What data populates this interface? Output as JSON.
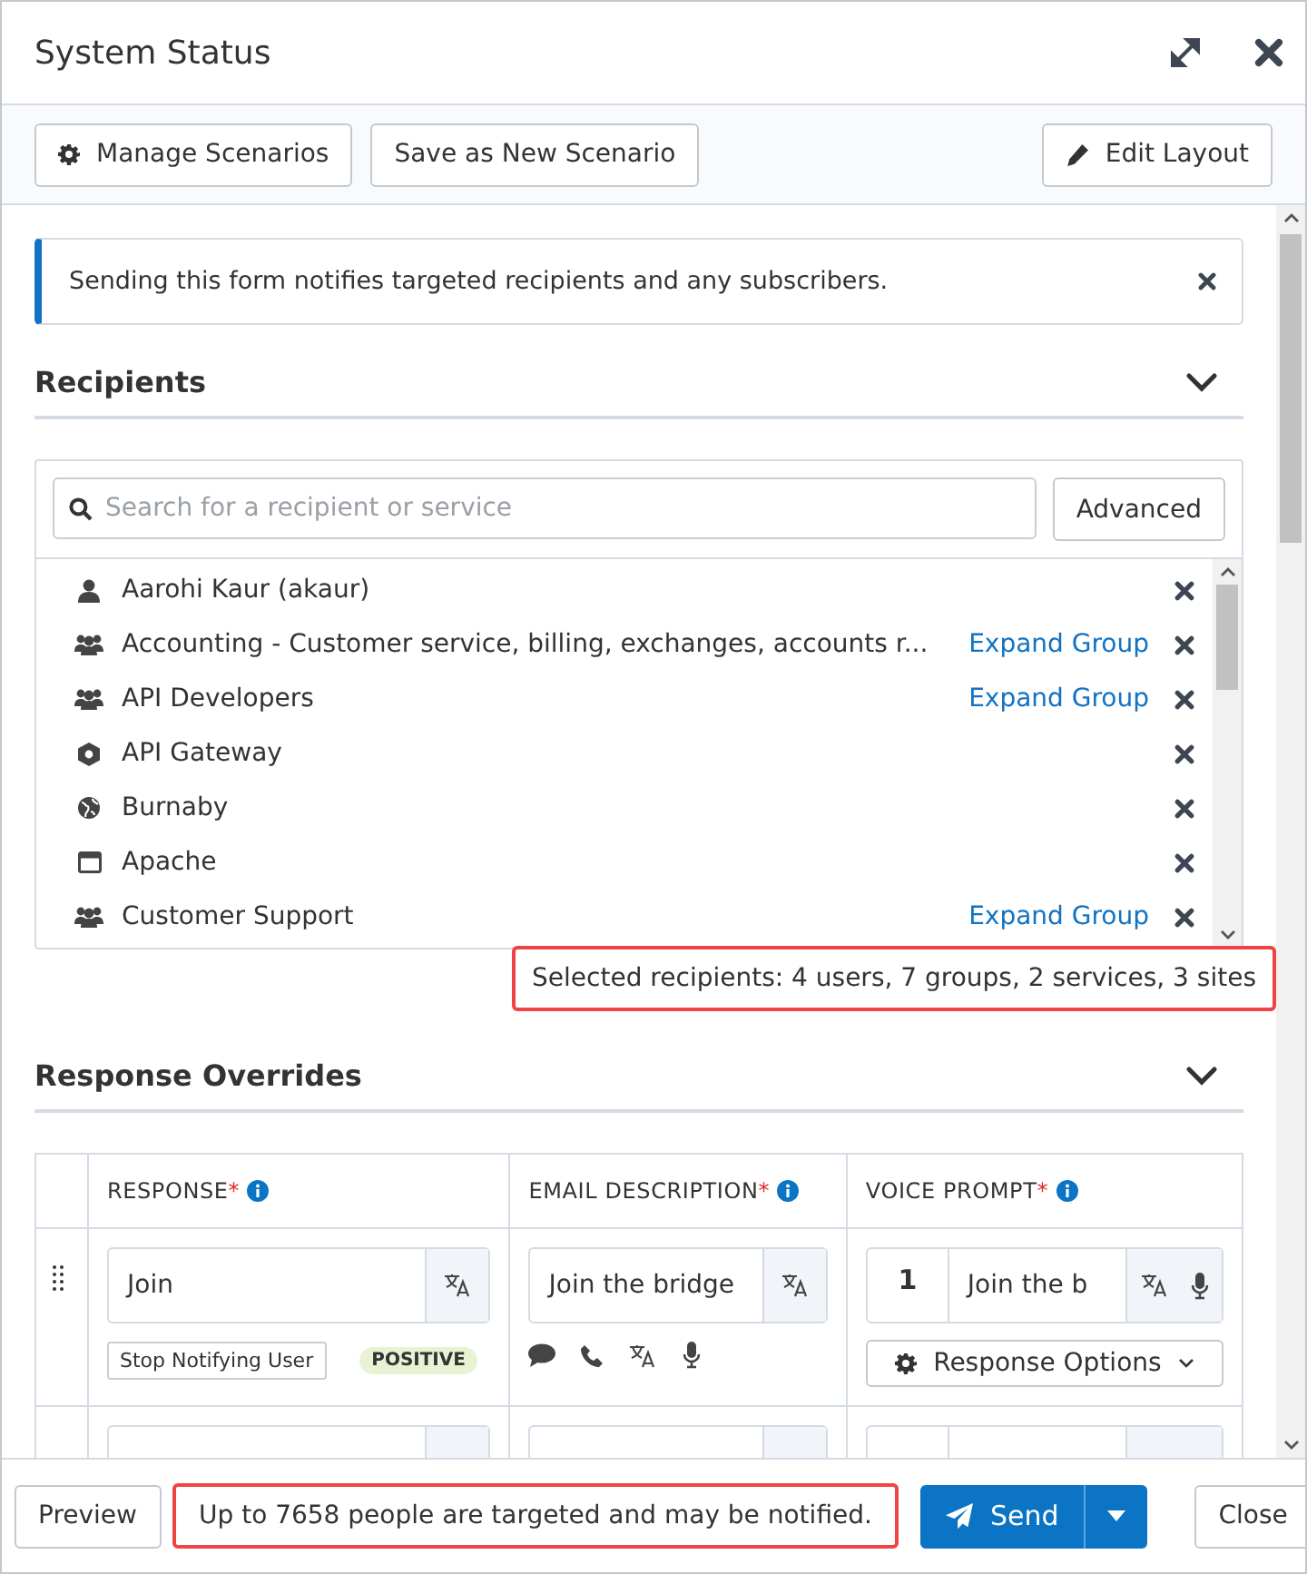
{
  "window": {
    "title": "System Status"
  },
  "toolbar": {
    "left_buttons": [
      {
        "label": "Manage Scenarios"
      },
      {
        "label": "Save as New Scenario"
      }
    ],
    "right_button": {
      "label": "Edit Layout"
    }
  },
  "banner": {
    "text": "Sending this form notifies targeted recipients and any subscribers."
  },
  "recipients": {
    "title": "Recipients",
    "expanded": true,
    "search": {
      "placeholder": "Search for a recipient or service"
    },
    "advanced_button": "Advanced",
    "items": [
      {
        "name": "Aarohi Kaur (akaur)",
        "kind": "user"
      },
      {
        "name": "Accounting - Customer service, billing, exchanges, accounts r...",
        "kind": "group",
        "link": "Expand Group"
      },
      {
        "name": "API Developers",
        "kind": "group",
        "link": "Expand Group"
      },
      {
        "name": "API Gateway",
        "kind": "service"
      },
      {
        "name": "Burnaby",
        "kind": "site"
      },
      {
        "name": "Apache",
        "kind": "app"
      },
      {
        "name": "Customer Support",
        "kind": "group",
        "link": "Expand Group"
      }
    ],
    "summary": {
      "text": "Selected recipients: 4 users, 7 groups, 2 services, 3 sites",
      "highlighted": true
    }
  },
  "response_overrides": {
    "title": "Response Overrides",
    "expanded": true,
    "columns": [
      {
        "label": "RESPONSE",
        "required_mark": "*"
      },
      {
        "label": "EMAIL DESCRIPTION",
        "required_mark": "*"
      },
      {
        "label": "VOICE PROMPT",
        "required_mark": "*"
      }
    ],
    "rows": [
      {
        "response": "Join",
        "email_description": "Join the bridge",
        "voice_number": "1",
        "voice_prompt": "Join the b",
        "stop_button": "Stop Notifying User",
        "tag": "POSITIVE",
        "options_button": "Response Options"
      }
    ]
  },
  "footer": {
    "preview": "Preview",
    "message": {
      "text": "Up to 7658 people are targeted and may be notified.",
      "highlighted": true
    },
    "send": "Send",
    "close": "Close"
  }
}
